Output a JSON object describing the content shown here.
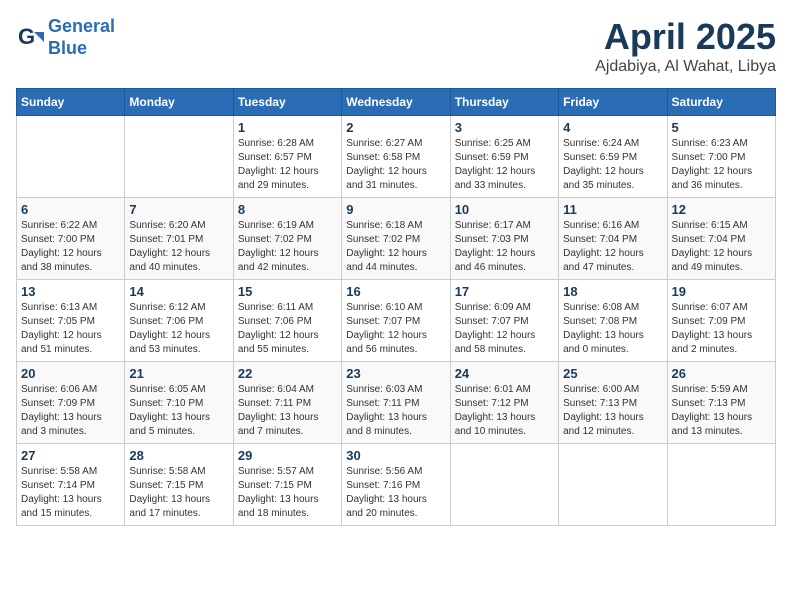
{
  "logo": {
    "line1": "General",
    "line2": "Blue"
  },
  "title": "April 2025",
  "location": "Ajdabiya, Al Wahat, Libya",
  "days_header": [
    "Sunday",
    "Monday",
    "Tuesday",
    "Wednesday",
    "Thursday",
    "Friday",
    "Saturday"
  ],
  "weeks": [
    [
      {
        "day": "",
        "info": ""
      },
      {
        "day": "",
        "info": ""
      },
      {
        "day": "1",
        "info": "Sunrise: 6:28 AM\nSunset: 6:57 PM\nDaylight: 12 hours\nand 29 minutes."
      },
      {
        "day": "2",
        "info": "Sunrise: 6:27 AM\nSunset: 6:58 PM\nDaylight: 12 hours\nand 31 minutes."
      },
      {
        "day": "3",
        "info": "Sunrise: 6:25 AM\nSunset: 6:59 PM\nDaylight: 12 hours\nand 33 minutes."
      },
      {
        "day": "4",
        "info": "Sunrise: 6:24 AM\nSunset: 6:59 PM\nDaylight: 12 hours\nand 35 minutes."
      },
      {
        "day": "5",
        "info": "Sunrise: 6:23 AM\nSunset: 7:00 PM\nDaylight: 12 hours\nand 36 minutes."
      }
    ],
    [
      {
        "day": "6",
        "info": "Sunrise: 6:22 AM\nSunset: 7:00 PM\nDaylight: 12 hours\nand 38 minutes."
      },
      {
        "day": "7",
        "info": "Sunrise: 6:20 AM\nSunset: 7:01 PM\nDaylight: 12 hours\nand 40 minutes."
      },
      {
        "day": "8",
        "info": "Sunrise: 6:19 AM\nSunset: 7:02 PM\nDaylight: 12 hours\nand 42 minutes."
      },
      {
        "day": "9",
        "info": "Sunrise: 6:18 AM\nSunset: 7:02 PM\nDaylight: 12 hours\nand 44 minutes."
      },
      {
        "day": "10",
        "info": "Sunrise: 6:17 AM\nSunset: 7:03 PM\nDaylight: 12 hours\nand 46 minutes."
      },
      {
        "day": "11",
        "info": "Sunrise: 6:16 AM\nSunset: 7:04 PM\nDaylight: 12 hours\nand 47 minutes."
      },
      {
        "day": "12",
        "info": "Sunrise: 6:15 AM\nSunset: 7:04 PM\nDaylight: 12 hours\nand 49 minutes."
      }
    ],
    [
      {
        "day": "13",
        "info": "Sunrise: 6:13 AM\nSunset: 7:05 PM\nDaylight: 12 hours\nand 51 minutes."
      },
      {
        "day": "14",
        "info": "Sunrise: 6:12 AM\nSunset: 7:06 PM\nDaylight: 12 hours\nand 53 minutes."
      },
      {
        "day": "15",
        "info": "Sunrise: 6:11 AM\nSunset: 7:06 PM\nDaylight: 12 hours\nand 55 minutes."
      },
      {
        "day": "16",
        "info": "Sunrise: 6:10 AM\nSunset: 7:07 PM\nDaylight: 12 hours\nand 56 minutes."
      },
      {
        "day": "17",
        "info": "Sunrise: 6:09 AM\nSunset: 7:07 PM\nDaylight: 12 hours\nand 58 minutes."
      },
      {
        "day": "18",
        "info": "Sunrise: 6:08 AM\nSunset: 7:08 PM\nDaylight: 13 hours\nand 0 minutes."
      },
      {
        "day": "19",
        "info": "Sunrise: 6:07 AM\nSunset: 7:09 PM\nDaylight: 13 hours\nand 2 minutes."
      }
    ],
    [
      {
        "day": "20",
        "info": "Sunrise: 6:06 AM\nSunset: 7:09 PM\nDaylight: 13 hours\nand 3 minutes."
      },
      {
        "day": "21",
        "info": "Sunrise: 6:05 AM\nSunset: 7:10 PM\nDaylight: 13 hours\nand 5 minutes."
      },
      {
        "day": "22",
        "info": "Sunrise: 6:04 AM\nSunset: 7:11 PM\nDaylight: 13 hours\nand 7 minutes."
      },
      {
        "day": "23",
        "info": "Sunrise: 6:03 AM\nSunset: 7:11 PM\nDaylight: 13 hours\nand 8 minutes."
      },
      {
        "day": "24",
        "info": "Sunrise: 6:01 AM\nSunset: 7:12 PM\nDaylight: 13 hours\nand 10 minutes."
      },
      {
        "day": "25",
        "info": "Sunrise: 6:00 AM\nSunset: 7:13 PM\nDaylight: 13 hours\nand 12 minutes."
      },
      {
        "day": "26",
        "info": "Sunrise: 5:59 AM\nSunset: 7:13 PM\nDaylight: 13 hours\nand 13 minutes."
      }
    ],
    [
      {
        "day": "27",
        "info": "Sunrise: 5:58 AM\nSunset: 7:14 PM\nDaylight: 13 hours\nand 15 minutes."
      },
      {
        "day": "28",
        "info": "Sunrise: 5:58 AM\nSunset: 7:15 PM\nDaylight: 13 hours\nand 17 minutes."
      },
      {
        "day": "29",
        "info": "Sunrise: 5:57 AM\nSunset: 7:15 PM\nDaylight: 13 hours\nand 18 minutes."
      },
      {
        "day": "30",
        "info": "Sunrise: 5:56 AM\nSunset: 7:16 PM\nDaylight: 13 hours\nand 20 minutes."
      },
      {
        "day": "",
        "info": ""
      },
      {
        "day": "",
        "info": ""
      },
      {
        "day": "",
        "info": ""
      }
    ]
  ]
}
